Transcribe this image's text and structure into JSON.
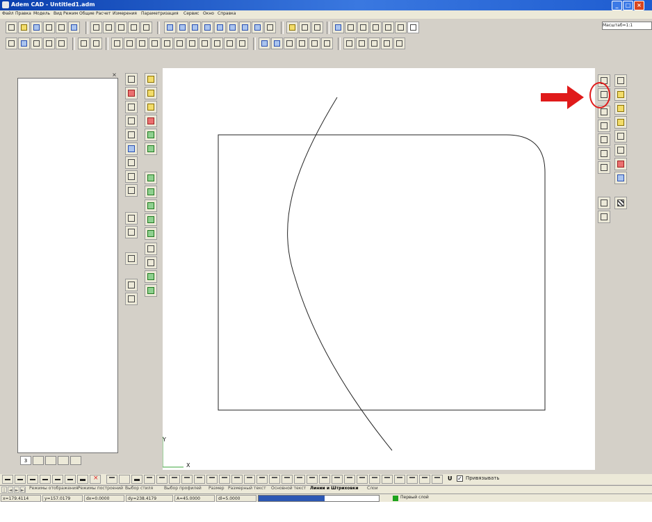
{
  "window": {
    "title": "Adem CAD - Untitled1.adm",
    "minimize": "_",
    "maximize": "□",
    "close": "×"
  },
  "menu": [
    "Файл",
    "Правка",
    "Модель",
    "Вид",
    "Режим",
    "Общие",
    "Расчет",
    "Измерения",
    "Параметризация",
    "Сервис",
    "Окно",
    "Справка"
  ],
  "scale_field": "Масштаб=1:1",
  "left_panel": {
    "close_glyph": "×",
    "tab_label": "3"
  },
  "drawing": {
    "axis_y": "Y",
    "axis_x": "X",
    "annotation_color": "#e01a1a"
  },
  "linebar": {
    "u_label": "U",
    "snap_checked": "✓",
    "snap_label": "Привязывать"
  },
  "sheet_tabs": {
    "nav": [
      "|◄",
      "◄",
      "►",
      "►|"
    ],
    "tabs": [
      {
        "label": "Режимы отображения",
        "active": false
      },
      {
        "label": "Режимы построений",
        "active": false
      },
      {
        "label": "Выбор стиля",
        "active": false
      },
      {
        "label": "Выбор профилей",
        "active": false
      },
      {
        "label": "Размер",
        "active": false
      },
      {
        "label": "Размерный текст",
        "active": false
      },
      {
        "label": "Основной текст",
        "active": false
      },
      {
        "label": "Линии и Штриховки",
        "active": true
      },
      {
        "label": "Слои",
        "active": false
      }
    ]
  },
  "status": {
    "x": "x=179.4114",
    "y": "y=157.0179",
    "dx": "dx=0.0000",
    "dy": "dy=238.4179",
    "angle": "A=45.0000",
    "step": "dl=5.0000",
    "progress": 0.55,
    "layer_color": "#1da31d",
    "layer": "Первый слой"
  }
}
